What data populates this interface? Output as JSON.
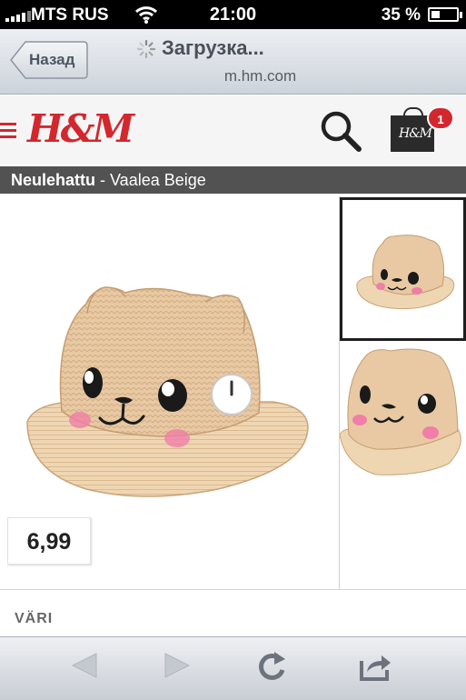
{
  "status_bar": {
    "carrier": "MTS RUS",
    "time": "21:00",
    "battery": "35 %",
    "battery_level": 0.35
  },
  "browser": {
    "back_label": "Назад",
    "title": "Загрузка...",
    "url": "m.hm.com"
  },
  "site": {
    "logo": "H&M",
    "bag_logo": "H&M",
    "cart_count": "1",
    "brand_color": "#d3272e"
  },
  "product": {
    "name": "Neulehattu",
    "separator": " - ",
    "color_name": "Vaalea Beige",
    "price": "6,99",
    "color_section_label": "VÄRI"
  },
  "icons": {
    "menu": "hamburger-icon",
    "search": "search-icon",
    "cart": "shopping-bag-icon",
    "back": "back-arrow-icon",
    "forward": "forward-arrow-icon",
    "reload": "reload-icon",
    "share": "share-icon"
  }
}
